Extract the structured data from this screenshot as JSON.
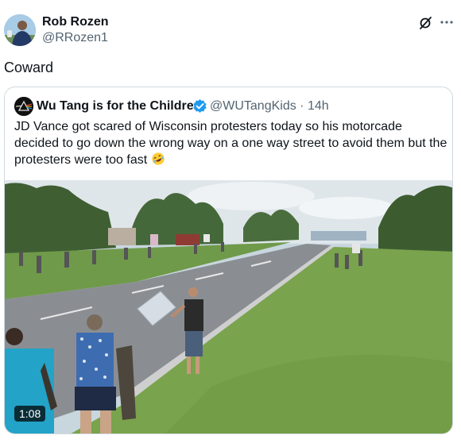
{
  "author": {
    "name": "Rob Rozen",
    "handle": "@RRozen1"
  },
  "tweet": {
    "text": "Coward"
  },
  "quote": {
    "name": "Wu Tang is for the Children",
    "handle": "@WUTangKids",
    "separator": "·",
    "time": "14h",
    "text": "JD Vance got scared of Wisconsin protesters today so his motorcade decided to go down the wrong way on a one way street to avoid them but the protesters were too fast",
    "emoji": "rolling-on-floor-laughing",
    "video_duration": "1:08"
  },
  "icons": {
    "verified": "verified-badge-icon",
    "grok": "grok-icon",
    "more": "more-options-icon"
  },
  "colors": {
    "verified_blue": "#1d9bf0",
    "secondary_text": "#536471",
    "border": "#cfd9de"
  }
}
